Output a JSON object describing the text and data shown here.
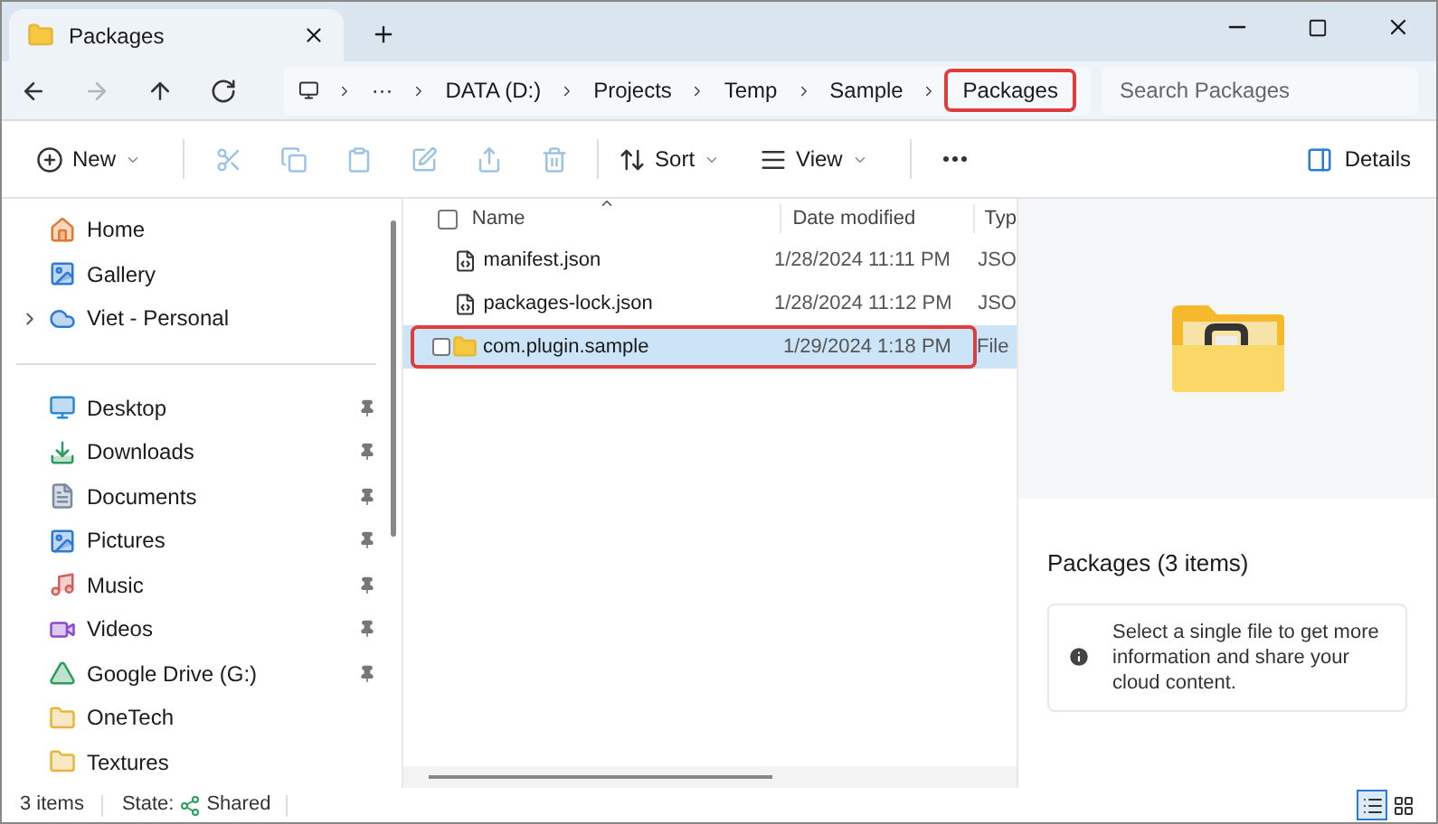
{
  "tabs": [
    {
      "title": "Packages",
      "selected": true
    }
  ],
  "nav": [
    {
      "kind": "back",
      "disabled": false
    },
    {
      "kind": "forward",
      "disabled": true
    },
    {
      "kind": "up",
      "disabled": false
    },
    {
      "kind": "refresh",
      "disabled": false
    }
  ],
  "breadcrumb": [
    {
      "label": "···",
      "current": false
    },
    {
      "label": "DATA (D:)",
      "current": false
    },
    {
      "label": "Projects",
      "current": false
    },
    {
      "label": "Temp",
      "current": false
    },
    {
      "label": "Sample",
      "current": false
    },
    {
      "label": "Packages",
      "current": true
    }
  ],
  "search": {
    "placeholder": "Search Packages"
  },
  "toolbar": [
    {
      "kind": "new",
      "label": "New",
      "disabled": false
    },
    {
      "kind": "cut",
      "disabled": true
    },
    {
      "kind": "copy",
      "disabled": true
    },
    {
      "kind": "paste",
      "disabled": true
    },
    {
      "kind": "rename",
      "disabled": true
    },
    {
      "kind": "share",
      "disabled": true
    },
    {
      "kind": "delete",
      "disabled": true
    },
    {
      "kind": "sort",
      "label": "Sort",
      "disabled": false
    },
    {
      "kind": "view",
      "label": "View",
      "disabled": false
    },
    {
      "kind": "more",
      "disabled": false
    }
  ],
  "details_button": {
    "label": "Details"
  },
  "sidebar": {
    "top": [
      {
        "kind": "home",
        "label": "Home",
        "expandable": false
      },
      {
        "kind": "gallery",
        "label": "Gallery",
        "expandable": false
      },
      {
        "kind": "cloud",
        "label": "Viet - Personal",
        "expandable": true
      }
    ],
    "pinned": [
      {
        "kind": "desktop",
        "label": "Desktop",
        "pinned": true
      },
      {
        "kind": "downloads",
        "label": "Downloads",
        "pinned": true
      },
      {
        "kind": "documents",
        "label": "Documents",
        "pinned": true
      },
      {
        "kind": "pictures",
        "label": "Pictures",
        "pinned": true
      },
      {
        "kind": "music",
        "label": "Music",
        "pinned": true
      },
      {
        "kind": "videos",
        "label": "Videos",
        "pinned": true
      },
      {
        "kind": "drive",
        "label": "Google Drive (G:)",
        "pinned": true
      },
      {
        "kind": "cloudfolder",
        "label": "OneTech",
        "pinned": false
      },
      {
        "kind": "folder",
        "label": "Textures",
        "pinned": false
      }
    ]
  },
  "table": {
    "select_all": {
      "checked": false
    },
    "columns": [
      "Name",
      "Date modified",
      "Typ"
    ],
    "rows": [
      {
        "kind": "json",
        "name": "manifest.json",
        "date": "1/28/2024 11:11 PM",
        "type": "JSO",
        "selected": false
      },
      {
        "kind": "json",
        "name": "packages-lock.json",
        "date": "1/28/2024 11:12 PM",
        "type": "JSO",
        "selected": false
      },
      {
        "kind": "folder",
        "name": "com.plugin.sample",
        "date": "1/29/2024 1:18 PM",
        "type": "File",
        "selected": true,
        "checked": false
      }
    ]
  },
  "details_pane": {
    "title": "Packages (3 items)",
    "info": "Select a single file to get more information and share your cloud content."
  },
  "status_bar": {
    "count": "3 items",
    "state_label": "State:",
    "state_value": "Shared"
  },
  "view_buttons": [
    {
      "kind": "details",
      "selected": true
    },
    {
      "kind": "tiles",
      "selected": false
    }
  ]
}
